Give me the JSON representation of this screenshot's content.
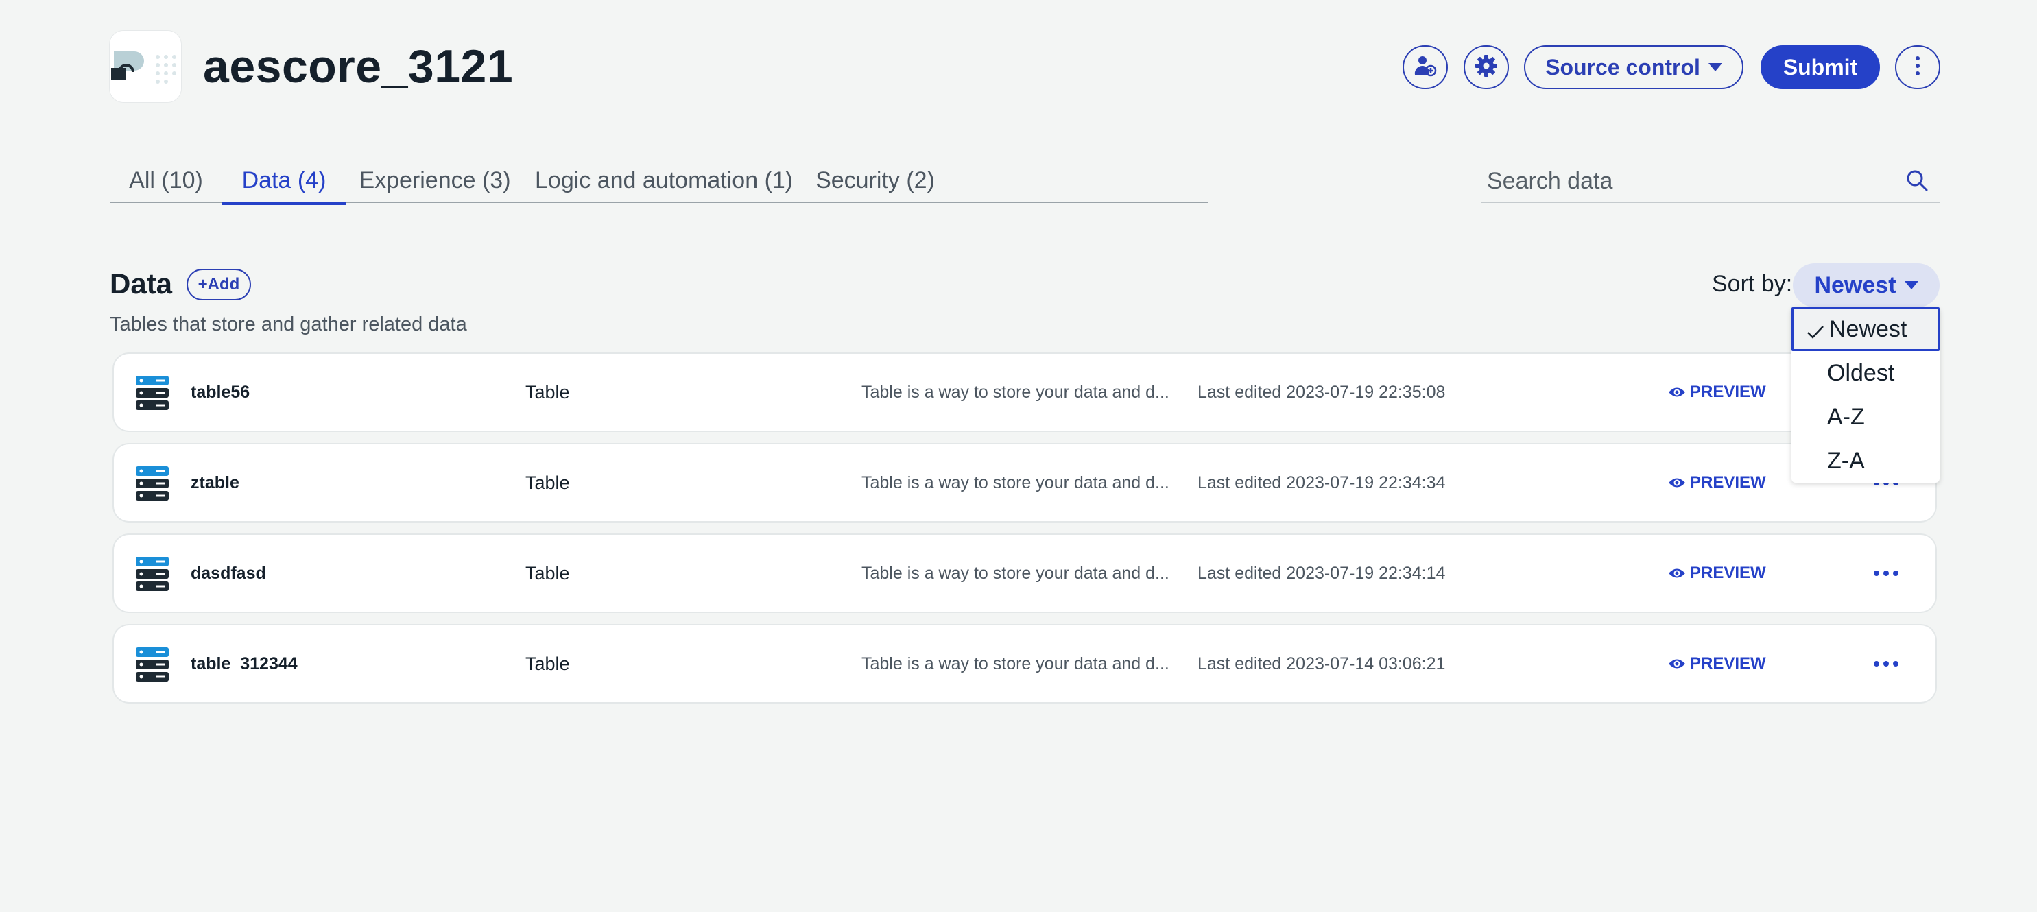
{
  "app": {
    "title": "aescore_3121",
    "logo_icon": "app-logo-icon"
  },
  "header": {
    "add_user_icon": "add-user-icon",
    "settings_icon": "gear-icon",
    "source_control_label": "Source control",
    "submit_label": "Submit",
    "more_icon": "more-vertical-icon"
  },
  "tabs": [
    {
      "label": "All (10)",
      "active": false
    },
    {
      "label": "Data (4)",
      "active": true
    },
    {
      "label": "Experience (3)",
      "active": false
    },
    {
      "label": "Logic and automation (1)",
      "active": false
    },
    {
      "label": "Security (2)",
      "active": false
    }
  ],
  "search": {
    "placeholder": "Search data",
    "value": ""
  },
  "section": {
    "title": "Data",
    "add_label": "+Add",
    "subtitle": "Tables that store and gather related data",
    "sort_label": "Sort by:",
    "sort_value": "Newest"
  },
  "sort_options": [
    {
      "label": "Newest",
      "selected": true
    },
    {
      "label": "Oldest",
      "selected": false
    },
    {
      "label": "A-Z",
      "selected": false
    },
    {
      "label": "Z-A",
      "selected": false
    }
  ],
  "rows": [
    {
      "name": "table56",
      "type": "Table",
      "description": "Table is a way to store your data and d...",
      "edited": "Last edited 2023-07-19 22:35:08",
      "preview": "PREVIEW"
    },
    {
      "name": "ztable",
      "type": "Table",
      "description": "Table is a way to store your data and d...",
      "edited": "Last edited 2023-07-19 22:34:34",
      "preview": "PREVIEW"
    },
    {
      "name": "dasdfasd",
      "type": "Table",
      "description": "Table is a way to store your data and d...",
      "edited": "Last edited 2023-07-19 22:34:14",
      "preview": "PREVIEW"
    },
    {
      "name": "table_312344",
      "type": "Table",
      "description": "Table is a way to store your data and d...",
      "edited": "Last edited 2023-07-14 03:06:21",
      "preview": "PREVIEW"
    }
  ],
  "colors": {
    "accent": "#2541c8",
    "background": "#f3f5f4",
    "text": "#15202b",
    "muted": "#4c5660"
  }
}
